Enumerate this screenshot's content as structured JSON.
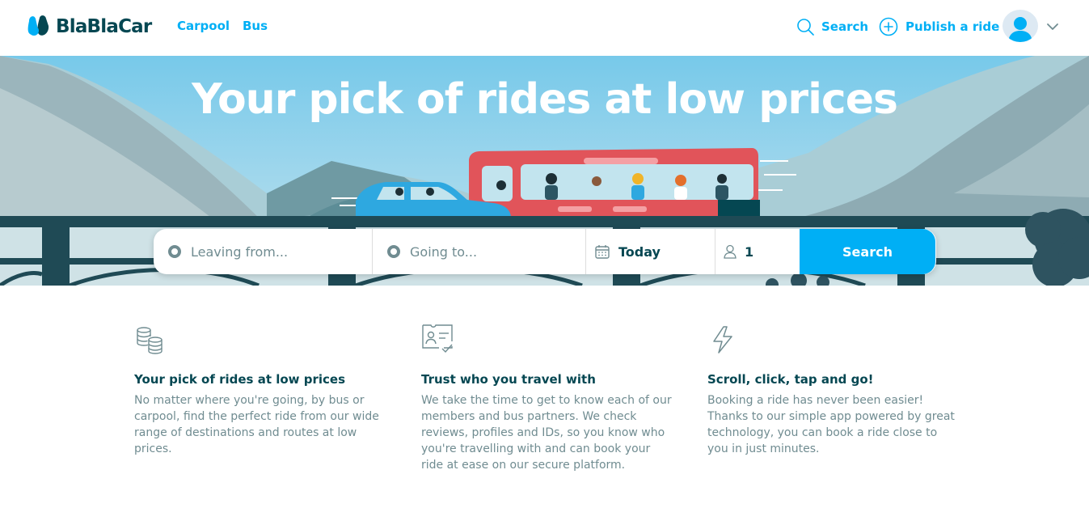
{
  "header": {
    "logo_text": "BlaBlaCar",
    "nav": [
      {
        "label": "Carpool"
      },
      {
        "label": "Bus"
      }
    ],
    "search_label": "Search",
    "publish_label": "Publish a ride",
    "search_icon": "search-icon",
    "publish_icon": "plus-circle-icon"
  },
  "hero": {
    "title": "Your pick of rides at low prices"
  },
  "search_bar": {
    "from_placeholder": "Leaving from...",
    "to_placeholder": "Going to...",
    "date_value": "Today",
    "passengers_value": "1",
    "search_button": "Search"
  },
  "features": [
    {
      "icon": "coins-icon",
      "title": "Your pick of rides at low prices",
      "lines": [
        "No matter where you're going, by bus or",
        "carpool, find the perfect ride from our wide",
        "range of destinations and routes at low",
        "prices."
      ]
    },
    {
      "icon": "id-card-check-icon",
      "title": "Trust who you travel with",
      "lines": [
        "We take the time to get to know each of our",
        "members and bus partners. We check",
        "reviews, profiles and IDs, so you know who",
        "you're travelling with and can book your",
        "ride at ease on our secure platform."
      ]
    },
    {
      "icon": "lightning-icon",
      "title": "Scroll, click, tap and go!",
      "lines": [
        "Booking a ride has never been easier!",
        "Thanks to our simple app powered by great",
        "technology, you can book a ride close to",
        "you in just minutes."
      ]
    }
  ],
  "colors": {
    "brand_blue": "#00aff5",
    "dark_teal": "#054752",
    "muted_text": "#708c91",
    "bus_red": "#e1545a",
    "car_blue": "#2ea8e0"
  }
}
